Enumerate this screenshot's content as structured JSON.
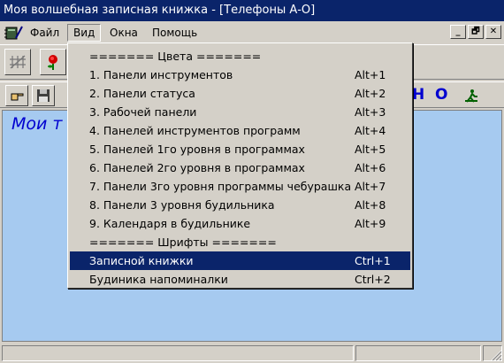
{
  "window": {
    "title": "Моя волшебная записная книжка - [Телефоны А-О]"
  },
  "menubar": {
    "items": [
      "Файл",
      "Вид",
      "Окна",
      "Помощь"
    ],
    "mdi_buttons": [
      "_",
      "🗗",
      "✕"
    ]
  },
  "toolbar2": {
    "letters": [
      "Н",
      "О"
    ]
  },
  "client": {
    "title": "Мои т"
  },
  "dropdown": {
    "items": [
      {
        "label": "======= Цвета =======",
        "shortcut": ""
      },
      {
        "label": "1. Панели инструментов",
        "shortcut": "Alt+1"
      },
      {
        "label": "2.  Панели статуса",
        "shortcut": "Alt+2"
      },
      {
        "label": "3. Рабочей панели",
        "shortcut": "Alt+3"
      },
      {
        "label": "4. Панелей инструментов программ",
        "shortcut": "Alt+4"
      },
      {
        "label": "5. Панелей 1го уровня в программах",
        "shortcut": "Alt+5"
      },
      {
        "label": "6. Панелей 2го уровня в программах",
        "shortcut": "Alt+6"
      },
      {
        "label": "7. Панели 3го уровня программы чебурашка",
        "shortcut": "Alt+7"
      },
      {
        "label": "8. Панели 3 уровня будильника",
        "shortcut": "Alt+8"
      },
      {
        "label": "9. Календаря в будильнике",
        "shortcut": "Alt+9"
      },
      {
        "label": "======= Шрифты =======",
        "shortcut": ""
      },
      {
        "label": "Записной книжки",
        "shortcut": "Ctrl+1"
      },
      {
        "label": "Будиника напоминалки",
        "shortcut": "Ctrl+2"
      }
    ]
  },
  "colors": {
    "titlebar": "#0a246a",
    "client_bg": "#a6caf0",
    "accent_text": "#0000d0",
    "selection": "#0a246a"
  }
}
